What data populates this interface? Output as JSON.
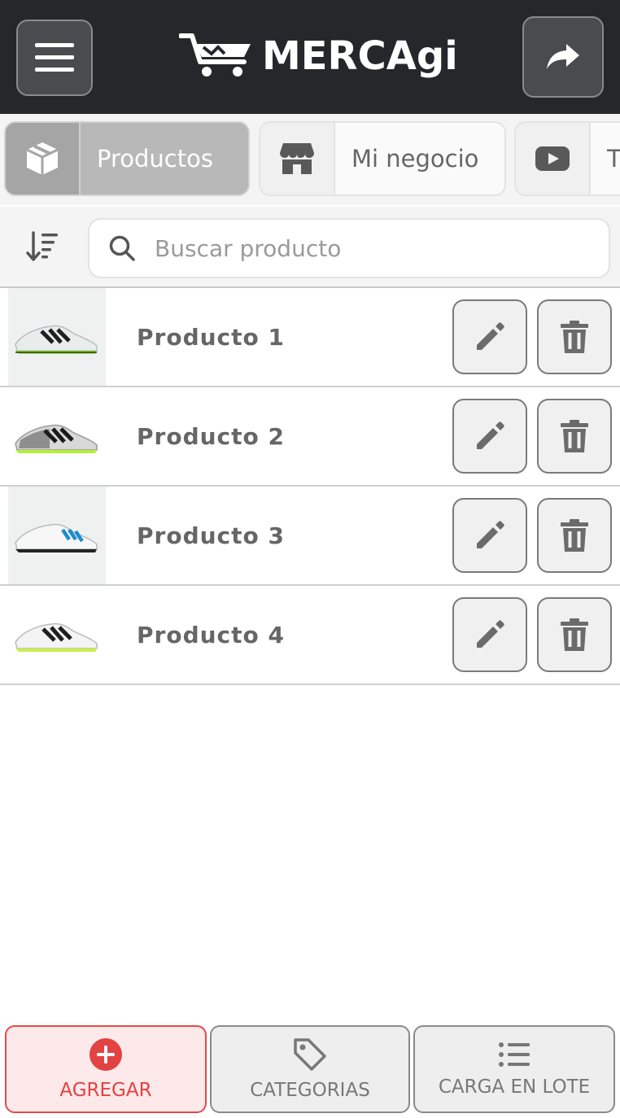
{
  "header": {
    "brand": "MERCAgi",
    "menu_icon": "hamburger-menu-icon",
    "share_icon": "share-arrow-icon",
    "colors": {
      "background": "#25272b",
      "button": "#4a4b4e"
    }
  },
  "tabs": [
    {
      "label": "Productos",
      "icon": "box-icon",
      "active": true
    },
    {
      "label": "Mi negocio",
      "icon": "store-icon",
      "active": false
    },
    {
      "label": "T",
      "icon": "video-play-icon",
      "active": false
    }
  ],
  "search": {
    "placeholder": "Buscar producto",
    "value": "",
    "sort_icon": "sort-descending-icon",
    "search_icon": "magnifier-icon"
  },
  "products": [
    {
      "name": "Producto 1",
      "image": "shoe-white-black-green"
    },
    {
      "name": "Producto 2",
      "image": "shoe-grey-black-green"
    },
    {
      "name": "Producto 3",
      "image": "shoe-white-blue"
    },
    {
      "name": "Producto 4",
      "image": "shoe-white-black-lime"
    }
  ],
  "row_actions": {
    "edit_icon": "pencil-icon",
    "delete_icon": "trash-icon"
  },
  "bottom_bar": {
    "add": {
      "label": "AGREGAR",
      "icon": "plus-circle-icon",
      "color": "#e34242"
    },
    "categories": {
      "label": "CATEGORIAS",
      "icon": "tag-icon"
    },
    "batch": {
      "label": "CARGA EN LOTE",
      "icon": "list-icon"
    }
  }
}
